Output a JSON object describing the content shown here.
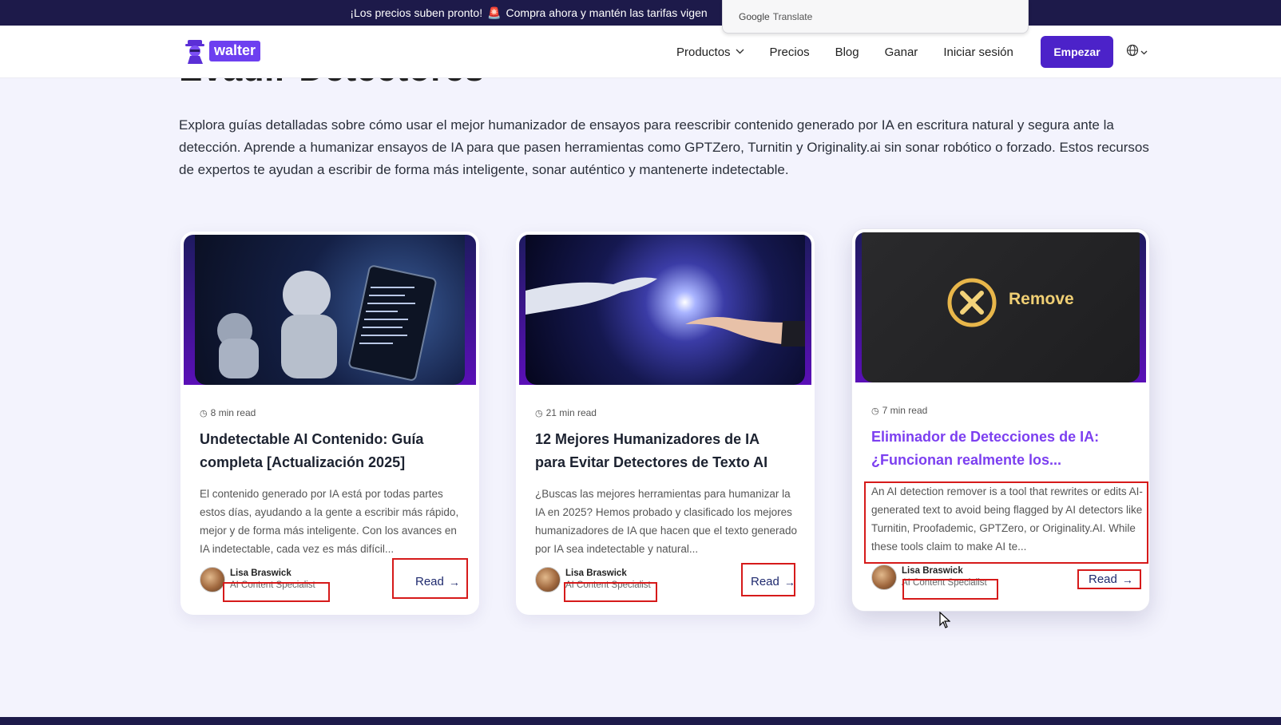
{
  "promo": {
    "text": "¡Los precios suben pronto!",
    "siren": "🚨",
    "text2": "Compra ahora y mantén las tarifas vigen"
  },
  "google_translate": {
    "brand": "Google",
    "label": "Translate"
  },
  "nav": {
    "logo": "walter",
    "links": [
      "Productos",
      "Precios",
      "Blog",
      "Ganar",
      "Iniciar sesión"
    ],
    "cta": "Empezar"
  },
  "page": {
    "heading": "Evadir Detectores",
    "intro": "Explora guías detalladas sobre cómo usar el mejor humanizador de ensayos para reescribir contenido generado por IA en escritura natural y segura ante la detección. Aprende a humanizar ensayos de IA para que pasen herramientas como GPTZero, Turnitin y Originality.ai sin sonar robótico o forzado. Estos recursos de expertos te ayudan a escribir de forma más inteligente, sonar auténtico y mantenerte indetectable."
  },
  "cards": [
    {
      "read_time": "8 min read",
      "title": "Undetectable AI Contenido: Guía completa [Actualización 2025]",
      "excerpt": "El contenido generado por IA está por todas partes estos días, ayudando a la gente a escribir más rápido, mejor y de forma más inteligente. Con los avances en IA indetectable, cada vez es más difícil...",
      "author": "Lisa Braswick",
      "role": "AI Content Specialist",
      "read": "Read"
    },
    {
      "read_time": "21 min read",
      "title": "12 Mejores Humanizadores de IA para Evitar Detectores de Texto AI",
      "excerpt": "¿Buscas las mejores herramientas para humanizar la IA en 2025? Hemos probado y clasificado los mejores humanizadores de IA que hacen que el texto generado por IA sea indetectable y natural...",
      "author": "Lisa Braswick",
      "role": "AI Content Specialist",
      "read": "Read"
    },
    {
      "read_time": "7 min read",
      "title": "Eliminador de Detecciones de IA: ¿Funcionan realmente los...",
      "excerpt": "An AI detection remover is a tool that rewrites or edits AI-generated text to avoid being flagged by AI detectors like Turnitin, Proofademic, GPTZero, or Originality.AI. While these tools claim to make AI te...",
      "author": "Lisa Braswick",
      "role": "AI Content Specialist",
      "read": "Read",
      "image_label": "Remove"
    }
  ],
  "colors": {
    "brand_purple": "#4c22c9",
    "accent_purple": "#7c3ff0",
    "banner_bg": "#1d1a4a",
    "highlight_red": "#d61a1a"
  }
}
